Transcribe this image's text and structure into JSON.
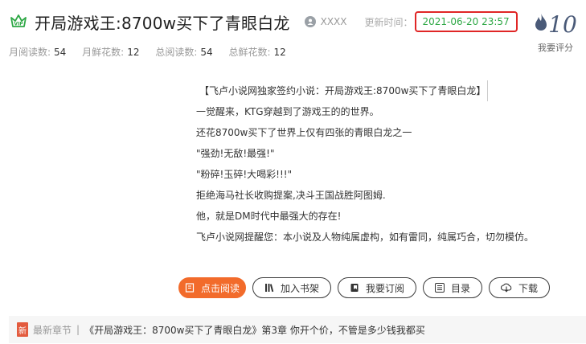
{
  "book": {
    "title": "开局游戏王:8700w买下了青眼白龙",
    "author": "XXXX",
    "update_label": "更新时间：",
    "update_time": "2021-06-20 23:57"
  },
  "stats": {
    "monthly_reads_label": "月阅读数:",
    "monthly_reads": "54",
    "monthly_flowers_label": "月鲜花数:",
    "monthly_flowers": "12",
    "total_reads_label": "总阅读数:",
    "total_reads": "54",
    "total_flowers_label": "总鲜花数:",
    "total_flowers": "12"
  },
  "rating": {
    "score": "10",
    "rate_label": "我要评分"
  },
  "description": [
    "【飞卢小说网独家签约小说：开局游戏王:8700w买下了青眼白龙】",
    "一觉醒来，KTG穿越到了游戏王的的世界。",
    "还花8700w买下了世界上仅有四张的青眼白龙之一",
    "\"强劲!无敌!最强!\"",
    "\"粉碎!玉碎!大喝彩!!!\"",
    "拒绝海马社长收购提案,决斗王国战胜阿图姆.",
    "他，就是DM时代中最强大的存在!",
    "飞卢小说网提醒您：本小说及人物纯属虚构，如有雷同，纯属巧合，切勿模仿。"
  ],
  "buttons": {
    "read": "点击阅读",
    "shelf": "加入书架",
    "subscribe": "我要订阅",
    "catalog": "目录",
    "download": "下载"
  },
  "latest": {
    "label": "最新章节",
    "separator": "|",
    "chapter": "《开局游戏王：8700w买下了青眼白龙》第3章 你开个价，不管是多少钱我都买"
  },
  "colors": {
    "accent": "#f26b2b",
    "update_time": "#2fa846",
    "highlight_box": "#e02626",
    "vip_icon": "#2fa846"
  }
}
